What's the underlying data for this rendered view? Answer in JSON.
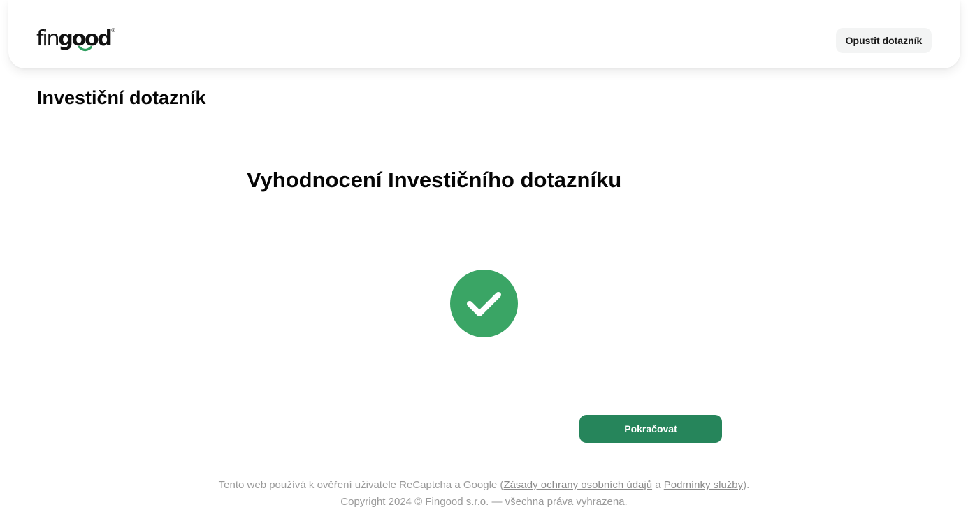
{
  "header": {
    "logo": {
      "text_regular": "fin",
      "text_bold": "good",
      "registered_mark": "®",
      "smile_color": "#2f9e5f"
    },
    "leave_button_label": "Opustit dotazník"
  },
  "main": {
    "page_title": "Investiční dotazník",
    "section_title": "Vyhodnocení Investičního dotazníku",
    "status_icon": "check-circle-icon",
    "status_color": "#3aa565",
    "continue_button_label": "Pokračovat",
    "continue_button_color": "#26855b"
  },
  "footer": {
    "recaptcha_text_before": "Tento web používá k ověření uživatele ReCaptcha a Google (",
    "privacy_link": "Zásady ochrany osobních údajů",
    "between": " a ",
    "terms_link": "Podmínky služby",
    "recaptcha_text_after": ").",
    "copyright": "Copyright 2024 © Fingood s.r.o. — všechna práva vyhrazena."
  }
}
